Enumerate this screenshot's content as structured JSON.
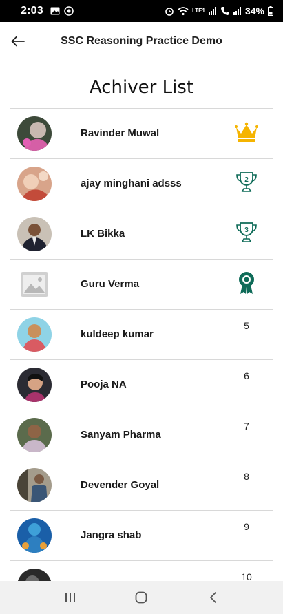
{
  "status_bar": {
    "time": "2:03",
    "battery": "34%",
    "network_label": "LTE1"
  },
  "app_bar": {
    "title": "SSC Reasoning Practice Demo",
    "back_icon": "arrow-left-icon"
  },
  "page": {
    "title": "Achiver List"
  },
  "achievers": [
    {
      "name": "Ravinder Muwal",
      "rank": "1",
      "badge": "crown-icon"
    },
    {
      "name": "ajay minghani adsss",
      "rank": "2",
      "badge": "trophy-2-icon"
    },
    {
      "name": "LK Bikka",
      "rank": "3",
      "badge": "trophy-3-icon"
    },
    {
      "name": "Guru Verma",
      "rank": "4",
      "badge": "medal-icon"
    },
    {
      "name": "kuldeep kumar",
      "rank": "5"
    },
    {
      "name": "Pooja NA",
      "rank": "6"
    },
    {
      "name": "Sanyam Pharma",
      "rank": "7"
    },
    {
      "name": "Devender Goyal",
      "rank": "8"
    },
    {
      "name": "Jangra shab",
      "rank": "9"
    },
    {
      "name": "",
      "rank": "10"
    }
  ],
  "colors": {
    "crown": "#f5b400",
    "trophy": "#0e6b58",
    "divider": "#d8d8d8"
  },
  "nav_bar": {
    "buttons": [
      "recents-icon",
      "home-icon",
      "back-icon"
    ]
  }
}
